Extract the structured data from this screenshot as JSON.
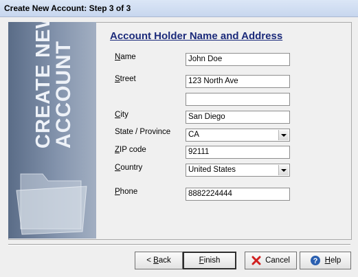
{
  "window": {
    "title": "Create New Account: Step 3 of 3"
  },
  "side_banner": {
    "line1": "CREATE NEW",
    "line2": "ACCOUNT"
  },
  "section": {
    "title": "Account Holder Name and Address"
  },
  "form": {
    "name": {
      "label_mn": "N",
      "label_rest": "ame",
      "value": "John Doe"
    },
    "street": {
      "label_mn": "S",
      "label_rest": "treet",
      "value": "123 North Ave",
      "value2": ""
    },
    "city": {
      "label_mn": "C",
      "label_rest": "ity",
      "value": "San Diego"
    },
    "state": {
      "label": "State / Province",
      "value": "CA"
    },
    "zip": {
      "label_mn": "Z",
      "label_rest": "IP code",
      "value": "92111"
    },
    "country": {
      "label_mn": "C",
      "label_rest": "ountry",
      "value": "United States"
    },
    "phone": {
      "label_mn": "P",
      "label_rest": "hone",
      "value": "8882224444"
    }
  },
  "buttons": {
    "back": {
      "arrow": "<",
      "mn": "B",
      "rest": "ack"
    },
    "finish": {
      "mn": "F",
      "rest": "inish"
    },
    "cancel": {
      "mn": "",
      "rest": "Cancel",
      "icon": "close-icon",
      "icon_color": "#d11f1f"
    },
    "help": {
      "mn": "H",
      "rest": "elp",
      "icon": "help-icon",
      "icon_color": "#2a5fb0"
    }
  }
}
